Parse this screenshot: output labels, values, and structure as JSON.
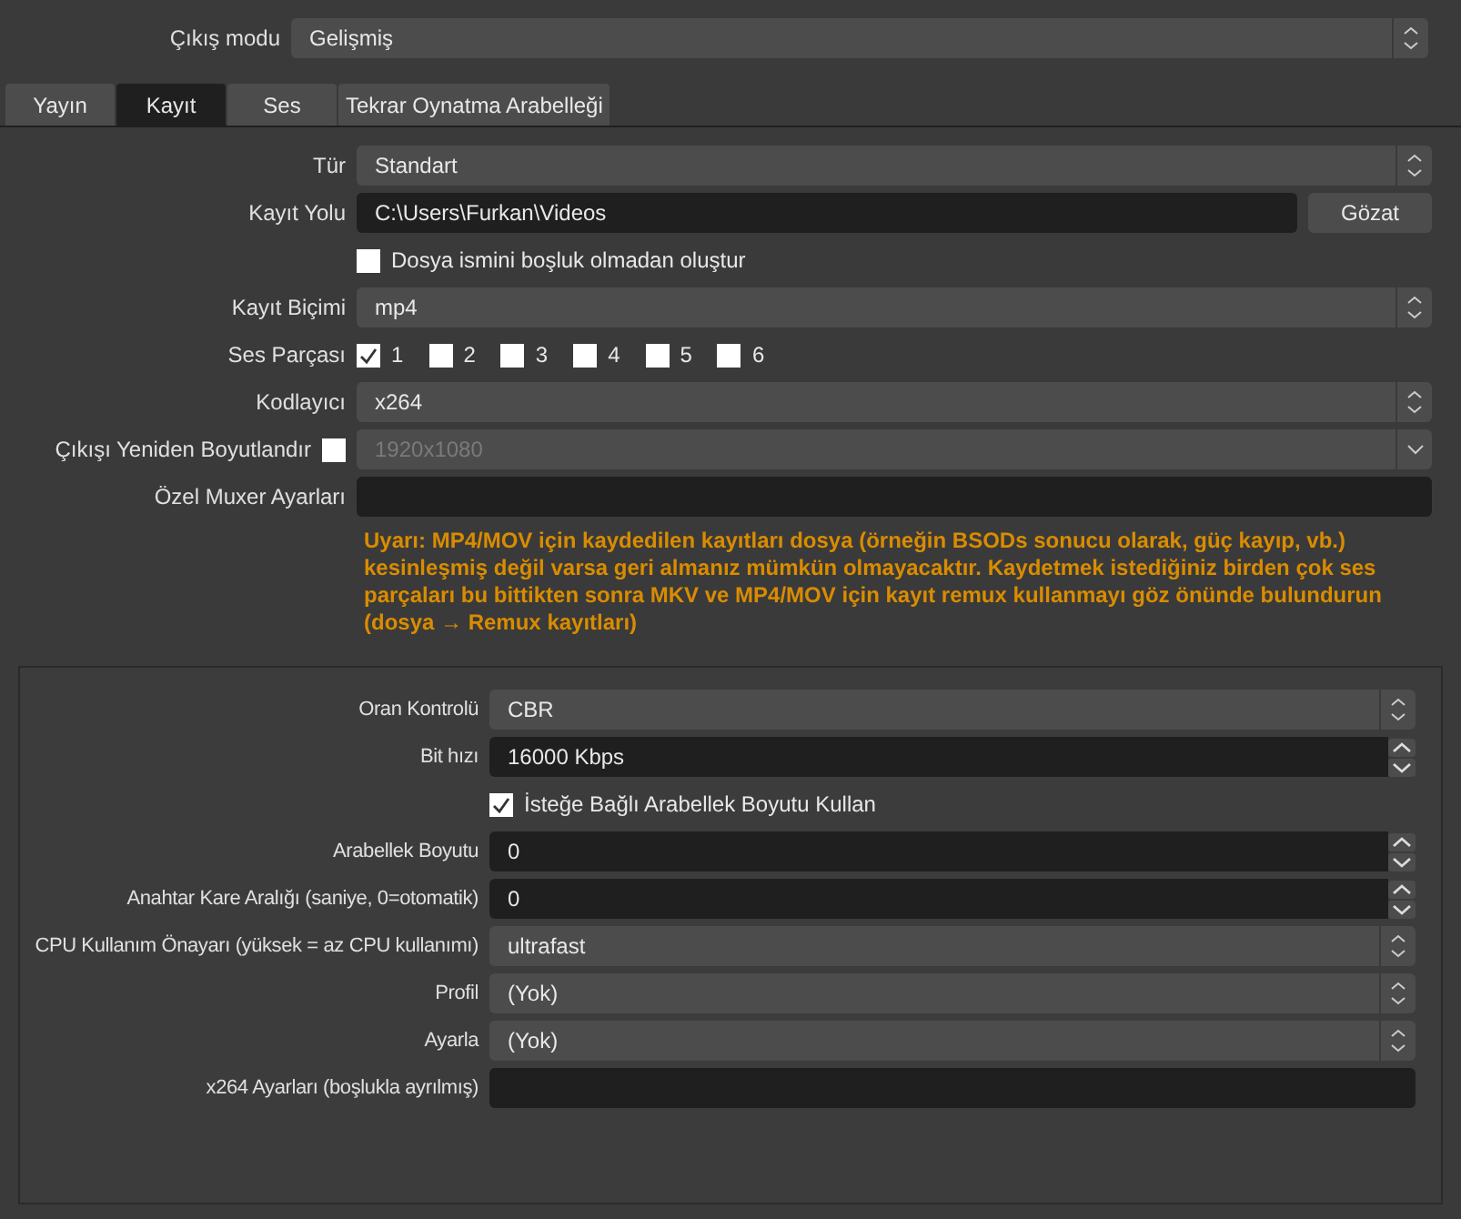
{
  "output_mode": {
    "label": "Çıkış modu",
    "value": "Gelişmiş"
  },
  "tabs": [
    {
      "label": "Yayın",
      "selected": false
    },
    {
      "label": "Kayıt",
      "selected": true
    },
    {
      "label": "Ses",
      "selected": false
    },
    {
      "label": "Tekrar Oynatma Arabelleği",
      "selected": false
    }
  ],
  "recording": {
    "rows": [
      {
        "kind": "select",
        "label": "Tür",
        "value": "Standart"
      },
      {
        "kind": "path",
        "label": "Kayıt Yolu",
        "value": "C:\\Users\\Furkan\\Videos",
        "button": "Gözat"
      },
      {
        "kind": "checkbox",
        "label": "Dosya ismini boşluk olmadan oluştur",
        "checked": false
      },
      {
        "kind": "select",
        "label": "Kayıt Biçimi",
        "value": "mp4"
      },
      {
        "kind": "tracks",
        "label": "Ses Parçası",
        "tracks": [
          {
            "label": "1",
            "checked": true
          },
          {
            "label": "2",
            "checked": false
          },
          {
            "label": "3",
            "checked": false
          },
          {
            "label": "4",
            "checked": false
          },
          {
            "label": "5",
            "checked": false
          },
          {
            "label": "6",
            "checked": false
          }
        ]
      },
      {
        "kind": "select",
        "label": "Kodlayıcı",
        "value": "x264"
      },
      {
        "kind": "resize",
        "label": "Çıkışı Yeniden Boyutlandır",
        "checked": false,
        "value": "1920x1080",
        "disabled": true
      },
      {
        "kind": "text",
        "label": "Özel Muxer Ayarları"
      }
    ],
    "warning": "Uyarı: MP4/MOV için kaydedilen kayıtları dosya (örneğin BSODs sonucu olarak, güç kayıp, vb.) kesinleşmiş değil varsa geri almanız mümkün olmayacaktır. Kaydetmek istediğiniz birden çok ses parçaları bu bittikten sonra MKV ve MP4/MOV için kayıt remux kullanmayı göz önünde bulundurun (dosya → Remux kayıtları)"
  },
  "encoder_settings": {
    "rows": [
      {
        "kind": "select",
        "label": "Oran Kontrolü",
        "value": "CBR"
      },
      {
        "kind": "spin",
        "label": "Bit hızı",
        "value": "16000 Kbps"
      },
      {
        "kind": "checkbox",
        "label": "İsteğe Bağlı Arabellek Boyutu Kullan",
        "checked": true
      },
      {
        "kind": "spin",
        "label": "Arabellek Boyutu",
        "value": "0"
      },
      {
        "kind": "spin",
        "label": "Anahtar Kare Aralığı (saniye, 0=otomatik)",
        "value": "0"
      },
      {
        "kind": "select",
        "label": "CPU Kullanım Önayarı (yüksek = az CPU kullanımı)",
        "value": "ultrafast"
      },
      {
        "kind": "select",
        "label": "Profil",
        "value": "(Yok)"
      },
      {
        "kind": "select",
        "label": "Ayarla",
        "value": "(Yok)"
      },
      {
        "kind": "text",
        "label": "x264 Ayarları (boşlukla ayrılmış)"
      }
    ]
  }
}
